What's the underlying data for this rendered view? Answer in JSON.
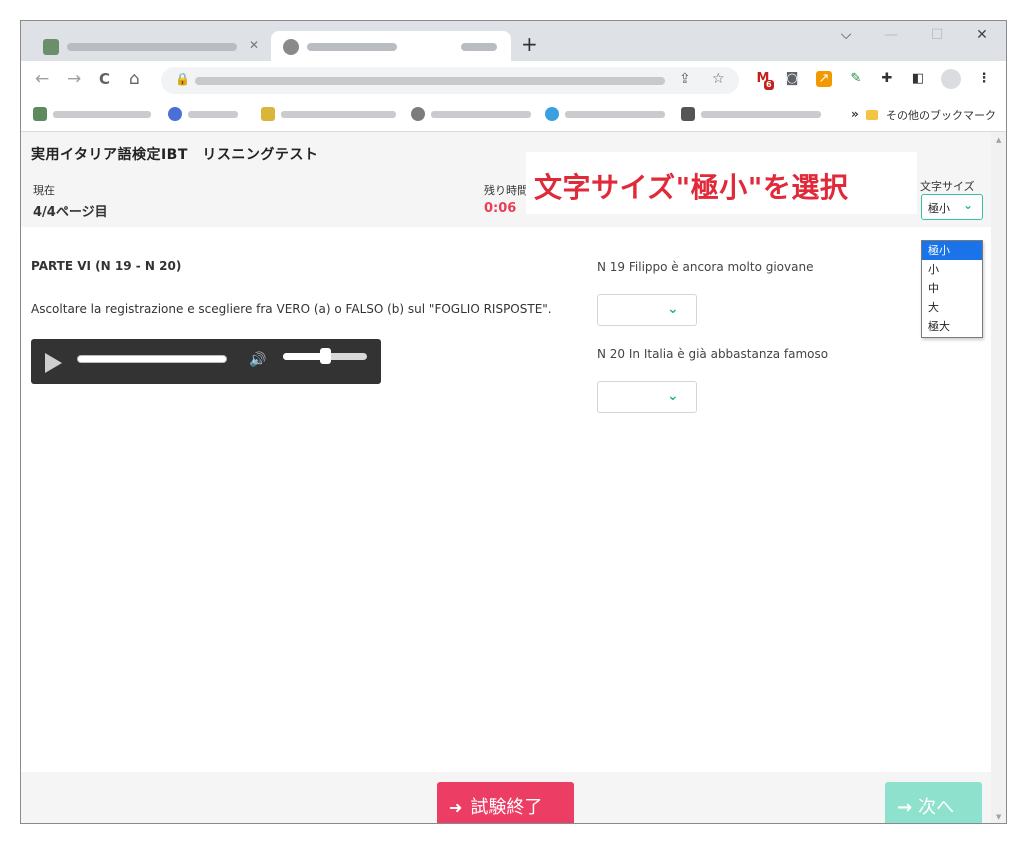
{
  "browser": {
    "tabs": [
      {
        "label": "",
        "active": false
      },
      {
        "label": "",
        "active": true
      }
    ],
    "new_tab_label": "+",
    "window_controls": {
      "menu": "⌵",
      "minimize": "—",
      "maximize": "☐",
      "close": "✕"
    },
    "nav": {
      "back": "←",
      "forward": "→",
      "reload": "C",
      "home": "⌂"
    },
    "omnibox_url": "",
    "gmail_badge": "6",
    "other_bookmarks_label": "その他のブックマーク",
    "bookmarks_more": "»"
  },
  "header": {
    "title": "実用イタリア語検定IBT　リスニングテスト",
    "current_label": "現在",
    "current_value": "4/4ページ目",
    "remaining_label": "残り時間",
    "remaining_value": "0:06",
    "annotation": "文字サイズ\"極小\"を選択",
    "fontsize_label": "文字サイズ",
    "fontsize_selected": "極小",
    "fontsize_options": [
      "極小",
      "小",
      "中",
      "大",
      "極大"
    ]
  },
  "content": {
    "part_title": "PARTE VI (N 19 - N 20)",
    "instructions": "Ascoltare la registrazione e scegliere fra VERO (a) o FALSO (b) sul \"FOGLIO RISPOSTE\".",
    "player": {
      "progress": 0,
      "volume": 0.5
    },
    "questions": [
      {
        "label": "N 19 Filippo è ancora molto giovane",
        "answer": ""
      },
      {
        "label": "N 20 In Italia è già abbastanza famoso",
        "answer": ""
      }
    ]
  },
  "footer": {
    "end_label": "試験終了",
    "next_label": "次へ"
  },
  "colors": {
    "accent": "#2bb596",
    "danger": "#ec3e64",
    "next_disabled": "#8ee2cd",
    "annotation": "#e02a3a"
  }
}
